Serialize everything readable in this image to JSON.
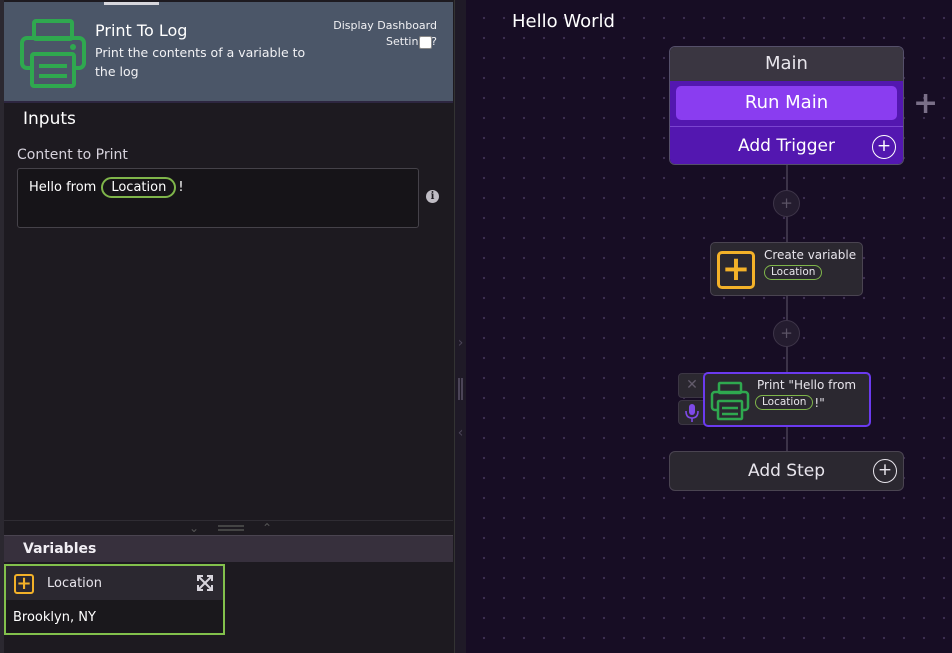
{
  "step_header": {
    "title": "Print To Log",
    "description": "Print the contents of a variable to the log",
    "dashboard_label": "Display Dashboard Settings?",
    "dashboard_checked": false,
    "icon": "printer-icon"
  },
  "inputs": {
    "title": "Inputs",
    "content_label": "Content to Print",
    "content_prefix": "Hello from",
    "content_variable": "Location",
    "content_suffix": "!",
    "info_glyph": "i"
  },
  "variables": {
    "title": "Variables",
    "items": [
      {
        "name": "Location",
        "value": "Brooklyn, NY",
        "icon": "add-variable-icon"
      }
    ]
  },
  "canvas": {
    "title": "Hello World",
    "main_node": {
      "title": "Main",
      "run_label": "Run Main",
      "add_trigger_label": "Add Trigger"
    },
    "steps": [
      {
        "title": "Create variable",
        "variable": "Location",
        "icon": "add-variable-icon"
      },
      {
        "title_prefix": "Print \"Hello from",
        "variable": "Location",
        "title_suffix": "!\"",
        "icon": "printer-icon"
      }
    ],
    "add_step_label": "Add Step"
  },
  "colors": {
    "accent_purple": "#8a3df0",
    "trigger_purple": "#5317b0",
    "variable_green": "#7fb54a",
    "variable_orange": "#f3b129",
    "printer_green": "#2fa84f"
  }
}
